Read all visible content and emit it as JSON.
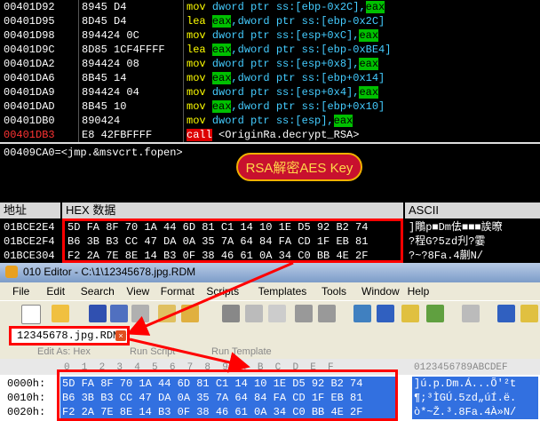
{
  "disasm": {
    "rows": [
      {
        "addr": "00401D92",
        "bytes": "8945 D4",
        "mnemonic": "mov",
        "pre": "dword ptr ss:[ebp-0x2C],",
        "reg1": "",
        "reg2": "eax"
      },
      {
        "addr": "00401D95",
        "bytes": "8D45 D4",
        "mnemonic": "lea",
        "pre": "",
        "reg1": "eax",
        "post": ",dword ptr ss:[ebp-0x2C]"
      },
      {
        "addr": "00401D98",
        "bytes": "894424 0C",
        "mnemonic": "mov",
        "pre": "dword ptr ss:[esp+0xC],",
        "reg2": "eax"
      },
      {
        "addr": "00401D9C",
        "bytes": "8D85 1CF4FFFF",
        "mnemonic": "lea",
        "reg1": "eax",
        "post": ",dword ptr ss:[ebp-0xBE4]"
      },
      {
        "addr": "00401DA2",
        "bytes": "894424 08",
        "mnemonic": "mov",
        "pre": "dword ptr ss:[esp+0x8],",
        "reg2": "eax"
      },
      {
        "addr": "00401DA6",
        "bytes": "8B45 14",
        "mnemonic": "mov",
        "reg1": "eax",
        "post": ",dword ptr ss:[ebp+0x14]"
      },
      {
        "addr": "00401DA9",
        "bytes": "894424 04",
        "mnemonic": "mov",
        "pre": "dword ptr ss:[esp+0x4],",
        "reg2": "eax"
      },
      {
        "addr": "00401DAD",
        "bytes": "8B45 10",
        "mnemonic": "mov",
        "reg1": "eax",
        "post": ",dword ptr ss:[ebp+0x10]"
      },
      {
        "addr": "00401DB0",
        "bytes": "890424",
        "mnemonic": "mov",
        "pre": "dword ptr ss:[esp],",
        "reg2": "eax"
      },
      {
        "addr": "00401DB3",
        "bytes": "E8 42FBFFFF",
        "mnemonic": "call",
        "call_target": "<OriginRa.decrypt_RSA>"
      }
    ],
    "info_line": "00409CA0=<jmp.&msvcrt.fopen>"
  },
  "annotation": {
    "label": "RSA解密AES Key"
  },
  "dump": {
    "col_addr": "地址",
    "col_hex": "HEX 数据",
    "col_ascii": "ASCII",
    "rows": [
      {
        "addr": "01BCE2E4",
        "hex": "5D FA 8F 70 1A 44 6D 81 C1 14 10 1E D5 92 B2 74",
        "ascii": "]鷼p■Dm佉■■■誒暸"
      },
      {
        "addr": "01BCE2F4",
        "hex": "B6 3B B3 CC 47 DA 0A 35 7A 64 84 FA CD 1F EB 81",
        "ascii": "?程G?5zd刋?霎"
      },
      {
        "addr": "01BCE304",
        "hex": "F2 2A 7E 8E 14 B3 0F 38 46 61 0A 34 C0 BB 4E 2F",
        "ascii": "?~?8Fa.4蒯N/"
      }
    ]
  },
  "editor": {
    "title": "010 Editor - C:\\1\\12345678.jpg.RDM",
    "menu": [
      "File",
      "Edit",
      "Search",
      "View",
      "Format",
      "Scripts",
      "Templates",
      "Tools",
      "Window",
      "Help"
    ],
    "file_tab": "12345678.jpg.RDM",
    "edit_as": "Edit As: Hex",
    "run_script": "Run Script",
    "run_template": "Run Template",
    "col_header_hex": "0  1  2  3  4  5  6  7  8  9  A  B  C  D  E  F",
    "col_header_ascii": "0123456789ABCDEF",
    "rows": [
      {
        "offset": "0000h:",
        "hex": "5D FA 8F 70 1A 44 6D 81 C1 14 10 1E D5 92 B2 74",
        "ascii": "]ú.p.Dm.Á...Õ'²t"
      },
      {
        "offset": "0010h:",
        "hex": "B6 3B B3 CC 47 DA 0A 35 7A 64 84 FA CD 1F EB 81",
        "ascii": "¶;³ÌGÚ.5zd„úÍ.ë."
      },
      {
        "offset": "0020h:",
        "hex": "F2 2A 7E 8E 14 B3 0F 38 46 61 0A 34 C0 BB 4E 2F",
        "ascii": "ò*~Ž.³.8Fa.4À»N/"
      }
    ]
  },
  "colors": {
    "accent_red": "#ff0000",
    "reg_green": "#00c000",
    "mnemonic_yellow": "#ffff00",
    "selection_blue": "#3270e0"
  }
}
